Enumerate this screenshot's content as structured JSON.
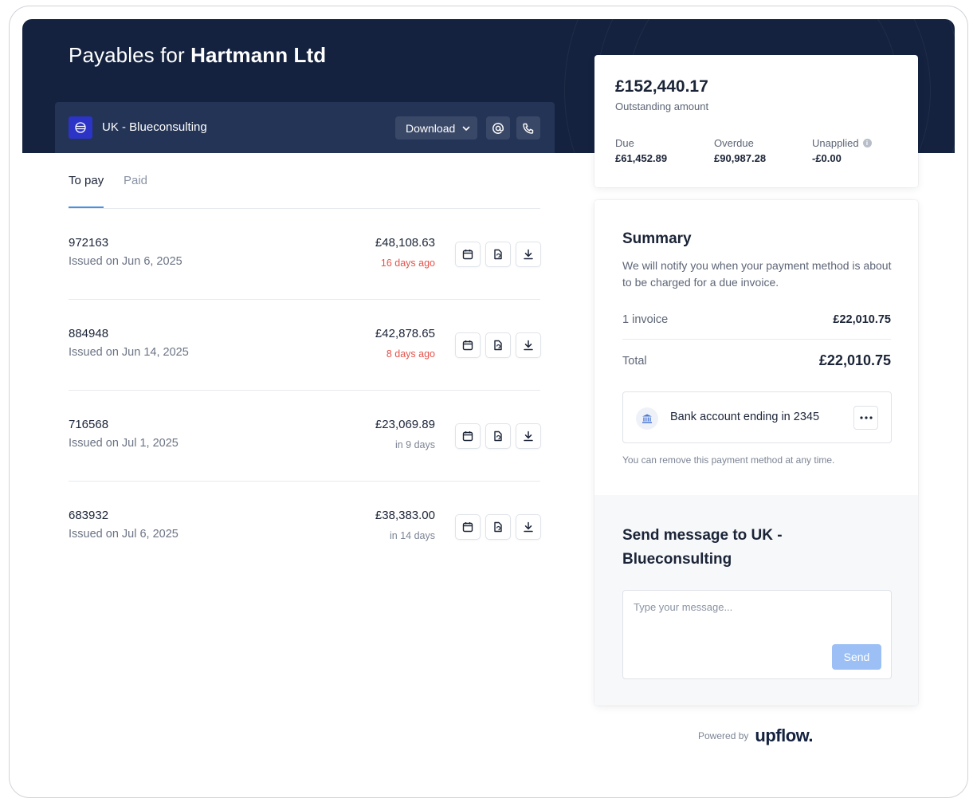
{
  "header": {
    "title_prefix": "Payables for",
    "company": "Hartmann Ltd"
  },
  "customer": {
    "name": "UK - Blueconsulting",
    "download_label": "Download"
  },
  "tabs": [
    {
      "label": "To pay",
      "active": true
    },
    {
      "label": "Paid",
      "active": false
    }
  ],
  "invoices": [
    {
      "number": "972163",
      "issued": "Issued on Jun 6, 2025",
      "amount": "£48,108.63",
      "due": "16 days ago",
      "overdue": true
    },
    {
      "number": "884948",
      "issued": "Issued on Jun 14, 2025",
      "amount": "£42,878.65",
      "due": "8 days ago",
      "overdue": true
    },
    {
      "number": "716568",
      "issued": "Issued on Jul 1, 2025",
      "amount": "£23,069.89",
      "due": "in 9 days",
      "overdue": false
    },
    {
      "number": "683932",
      "issued": "Issued on Jul 6, 2025",
      "amount": "£38,383.00",
      "due": "in 14 days",
      "overdue": false
    }
  ],
  "outstanding": {
    "amount": "£152,440.17",
    "label": "Outstanding amount",
    "due_label": "Due",
    "due_value": "£61,452.89",
    "overdue_label": "Overdue",
    "overdue_value": "£90,987.28",
    "unapplied_label": "Unapplied",
    "unapplied_value": "-£0.00"
  },
  "summary": {
    "title": "Summary",
    "description": "We will notify you when your payment method is about to be charged for a due invoice.",
    "invoice_count_label": "1 invoice",
    "invoice_count_value": "£22,010.75",
    "total_label": "Total",
    "total_value": "£22,010.75",
    "bank_label": "Bank account ending in 2345",
    "remove_note": "You can remove this payment method at any time."
  },
  "message": {
    "title": "Send message to UK - Blueconsulting",
    "placeholder": "Type your message...",
    "send_label": "Send"
  },
  "footer": {
    "powered_by": "Powered by",
    "brand": "upflow."
  },
  "colors": {
    "header_bg": "#14223f",
    "accent": "#4a90e2",
    "overdue": "#e5534b",
    "send_button": "#9cc0f5"
  }
}
